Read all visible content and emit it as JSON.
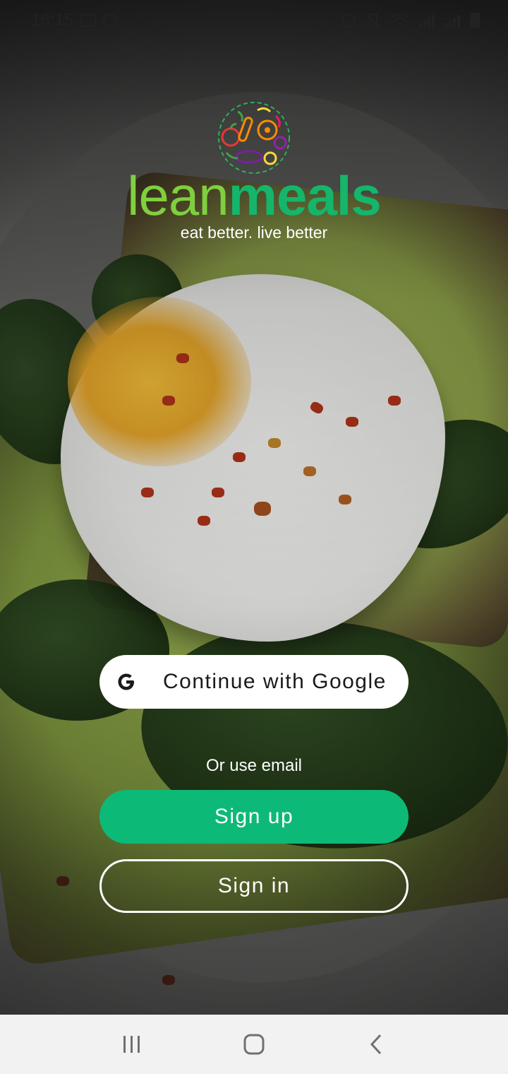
{
  "status_bar": {
    "time": "18:15",
    "left_icons": [
      "image-icon",
      "timer-icon"
    ],
    "right_icons": [
      "alarm-icon",
      "vibrate-icon",
      "wifi-icon",
      "signal-icon",
      "battery-icon"
    ]
  },
  "brand": {
    "name_part1": "lean",
    "name_part2": "meals",
    "tagline": "eat better. live better",
    "colors": {
      "lean": "#7fcf3f",
      "meals": "#15b56c"
    }
  },
  "auth": {
    "google_label": "Continue with Google",
    "divider_text": "Or use email",
    "signup_label": "Sign up",
    "signin_label": "Sign in",
    "accent": "#0db976"
  },
  "nav_bar": {
    "buttons": [
      "recents-icon",
      "home-icon",
      "back-icon"
    ]
  }
}
